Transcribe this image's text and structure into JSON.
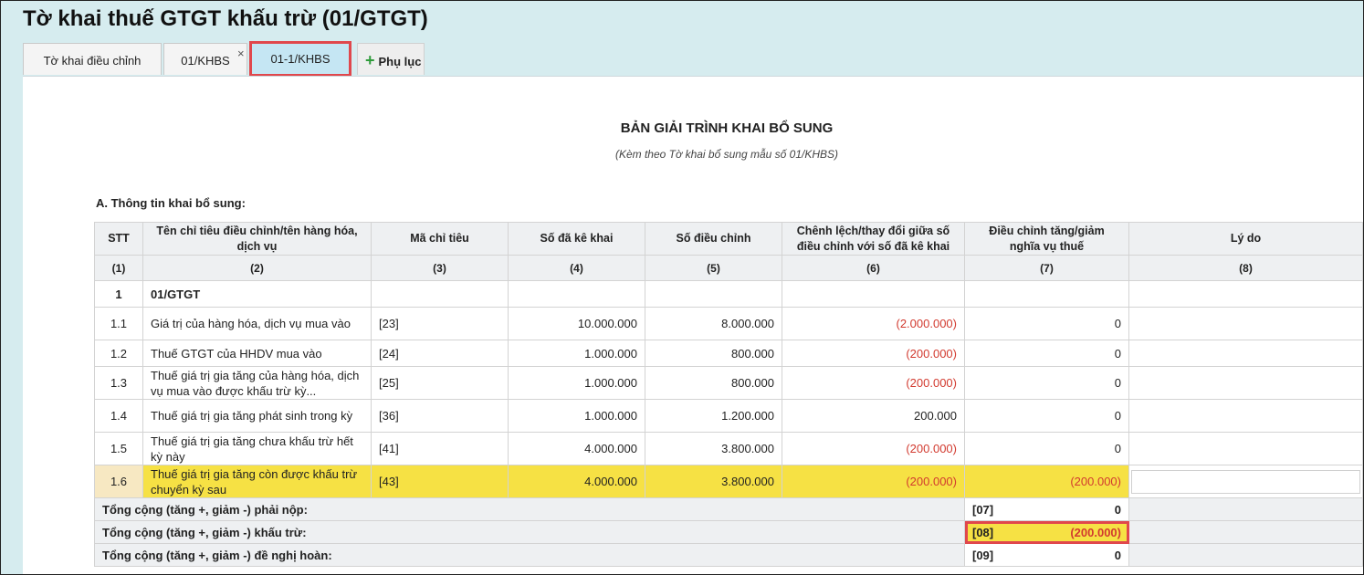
{
  "window": {
    "title": "Tờ khai thuế GTGT khấu trừ (01/GTGT)"
  },
  "tabs": [
    {
      "label": "Tờ khai điều chỉnh"
    },
    {
      "label": "01/KHBS"
    },
    {
      "label": "01-1/KHBS"
    }
  ],
  "tab_close": "×",
  "add_tab": {
    "label": "Phụ lục",
    "icon": "plus-icon"
  },
  "document": {
    "title": "BẢN GIẢI TRÌNH KHAI BỔ SUNG",
    "subtitle": "(Kèm theo Tờ khai bổ sung mẫu số 01/KHBS)",
    "section_a": "A. Thông tin khai bổ sung:"
  },
  "table": {
    "headers": [
      "STT",
      "Tên chỉ tiêu điều chỉnh/tên hàng hóa, dịch vụ",
      "Mã chỉ tiêu",
      "Số đã kê khai",
      "Số điều chỉnh",
      "Chênh lệch/thay đổi giữa số điều chỉnh với số đã kê khai",
      "Điều chỉnh tăng/giảm nghĩa vụ thuế",
      "Lý do"
    ],
    "column_numbers": [
      "(1)",
      "(2)",
      "(3)",
      "(4)",
      "(5)",
      "(6)",
      "(7)",
      "(8)"
    ],
    "group": {
      "stt": "1",
      "name": "01/GTGT"
    },
    "rows": [
      {
        "stt": "1.1",
        "name": "Giá trị của hàng hóa, dịch vụ mua vào",
        "code": "[23]",
        "declared": "10.000.000",
        "adjusted": "8.000.000",
        "diff": "(2.000.000)",
        "change": "0"
      },
      {
        "stt": "1.2",
        "name": "Thuế GTGT của HHDV mua vào",
        "code": "[24]",
        "declared": "1.000.000",
        "adjusted": "800.000",
        "diff": "(200.000)",
        "change": "0"
      },
      {
        "stt": "1.3",
        "name": "Thuế giá trị gia tăng của hàng hóa, dịch vụ mua vào được khấu trừ kỳ...",
        "code": "[25]",
        "declared": "1.000.000",
        "adjusted": "800.000",
        "diff": "(200.000)",
        "change": "0"
      },
      {
        "stt": "1.4",
        "name": "Thuế giá trị gia tăng phát sinh trong kỳ",
        "code": "[36]",
        "declared": "1.000.000",
        "adjusted": "1.200.000",
        "diff": "200.000",
        "change": "0"
      },
      {
        "stt": "1.5",
        "name": "Thuế giá trị gia tăng chưa khấu trừ hết kỳ này",
        "code": "[41]",
        "declared": "4.000.000",
        "adjusted": "3.800.000",
        "diff": "(200.000)",
        "change": "0"
      },
      {
        "stt": "1.6",
        "name": "Thuế giá trị gia tăng còn được khấu trừ chuyển kỳ sau",
        "code": "[43]",
        "declared": "4.000.000",
        "adjusted": "3.800.000",
        "diff": "(200.000)",
        "change": "(200.000)"
      }
    ],
    "totals": [
      {
        "label": "Tổng cộng (tăng +, giảm -) phải nộp:",
        "code": "[07]",
        "value": "0"
      },
      {
        "label": "Tổng cộng (tăng +, giảm -) khấu trừ:",
        "code": "[08]",
        "value": "(200.000)"
      },
      {
        "label": "Tổng cộng (tăng +, giảm -) đề nghị hoàn:",
        "code": "[09]",
        "value": "0"
      }
    ]
  },
  "colors": {
    "highlight": "#f6e144",
    "negative": "#d23a2f",
    "annotation": "#e0474c",
    "active_tab": "#c5e6f3"
  }
}
